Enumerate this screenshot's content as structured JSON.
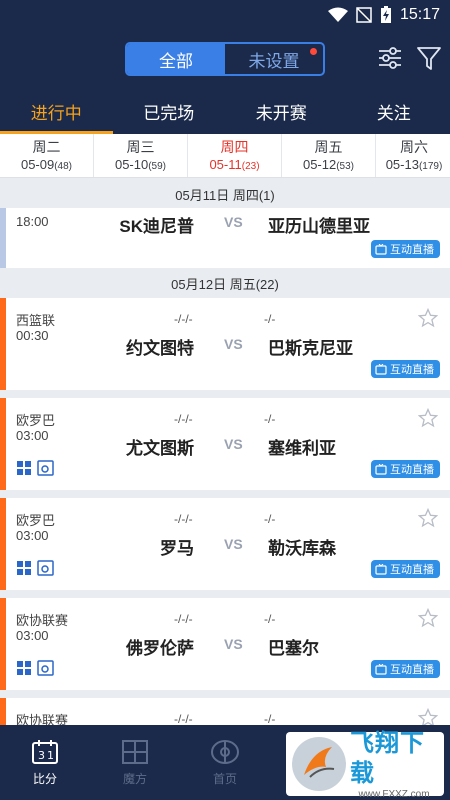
{
  "status_bar": {
    "time": "15:17"
  },
  "header": {
    "segments": [
      {
        "label": "全部",
        "active": true
      },
      {
        "label": "未设置",
        "active": false,
        "has_dot": true
      }
    ],
    "icons": [
      "settings-sliders-icon",
      "filter-icon"
    ]
  },
  "tabs": [
    {
      "label": "进行中",
      "active": true
    },
    {
      "label": "已完场",
      "active": false
    },
    {
      "label": "未开赛",
      "active": false
    },
    {
      "label": "关注",
      "active": false
    }
  ],
  "dates": [
    {
      "weekday": "周二",
      "date": "05-09",
      "count": "(48)",
      "selected": false
    },
    {
      "weekday": "周三",
      "date": "05-10",
      "count": "(59)",
      "selected": false
    },
    {
      "weekday": "周四",
      "date": "05-11",
      "count": "(23)",
      "selected": true
    },
    {
      "weekday": "周五",
      "date": "05-12",
      "count": "(53)",
      "selected": false
    },
    {
      "weekday": "周六",
      "date": "05-13",
      "count": "(179)",
      "selected": false
    }
  ],
  "sections": {
    "day1_header": "05月11日 周四(1)",
    "day2_header": "05月12日 周五(22)"
  },
  "matches": [
    {
      "league": "",
      "time": "18:00",
      "score_home": "",
      "score_away": "",
      "home": "SK迪尼普",
      "vs": "VS",
      "away": "亚历山德里亚",
      "live": "互动直播"
    },
    {
      "league": "西篮联",
      "time": "00:30",
      "score_home": "-/-/-",
      "score_away": "-/-",
      "home": "约文图特",
      "vs": "VS",
      "away": "巴斯克尼亚",
      "live": "互动直播"
    },
    {
      "league": "欧罗巴",
      "time": "03:00",
      "score_home": "-/-/-",
      "score_away": "-/-",
      "home": "尤文图斯",
      "vs": "VS",
      "away": "塞维利亚",
      "live": "互动直播"
    },
    {
      "league": "欧罗巴",
      "time": "03:00",
      "score_home": "-/-/-",
      "score_away": "-/-",
      "home": "罗马",
      "vs": "VS",
      "away": "勒沃库森",
      "live": "互动直播"
    },
    {
      "league": "欧协联赛",
      "time": "03:00",
      "score_home": "-/-/-",
      "score_away": "-/-",
      "home": "佛罗伦萨",
      "vs": "VS",
      "away": "巴塞尔",
      "live": "互动直播"
    },
    {
      "league": "欧协联赛",
      "time": "",
      "score_home": "-/-/-",
      "score_away": "-/-",
      "home": "",
      "vs": "",
      "away": "",
      "live": ""
    }
  ],
  "bottom_nav": [
    {
      "label": "比分",
      "icon": "calendar-icon",
      "active": true
    },
    {
      "label": "魔方",
      "icon": "cube-icon",
      "active": false
    },
    {
      "label": "首页",
      "icon": "field-icon",
      "active": false
    }
  ],
  "watermark": {
    "big": "飞翔下载",
    "small": "www.FXXZ.com"
  }
}
